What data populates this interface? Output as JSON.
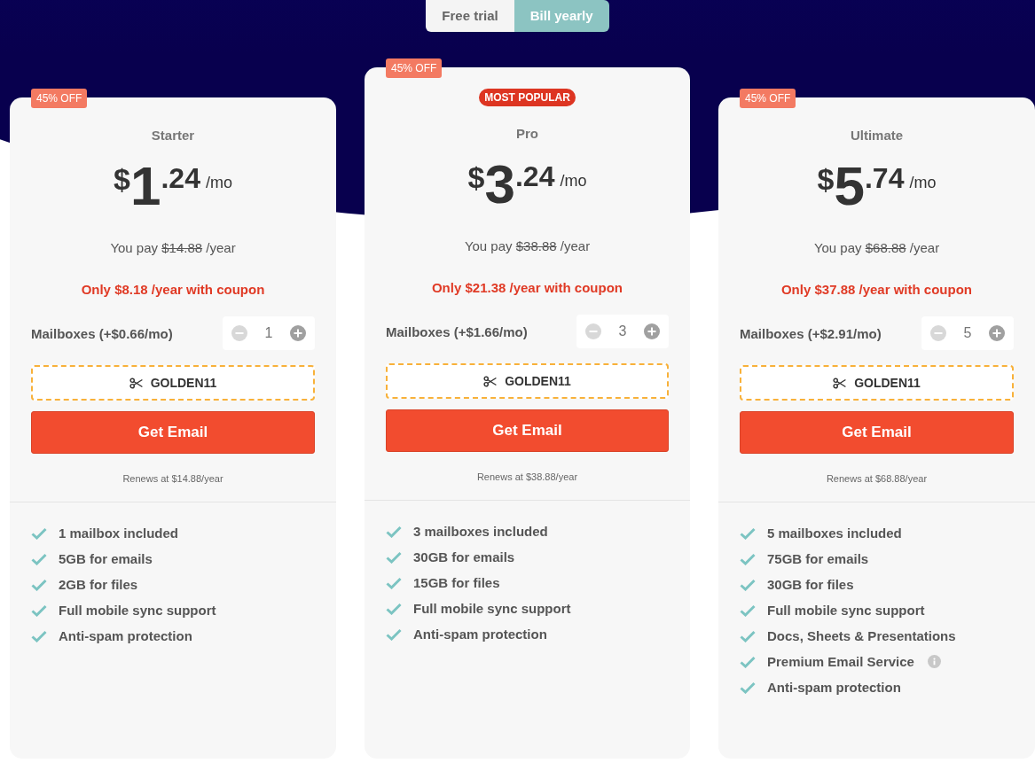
{
  "billing_toggle": [
    {
      "label": "Free trial",
      "selected": false
    },
    {
      "label": "Bill yearly",
      "selected": true
    }
  ],
  "plans": [
    {
      "discount_badge": "45% OFF",
      "name": "Starter",
      "price": {
        "currency": "$",
        "whole": "1",
        "cents": ".24",
        "period": "/mo"
      },
      "you_pay": {
        "prefix": "You pay",
        "old_price": "$14.88",
        "suffix": "/year"
      },
      "coupon_offer": "Only $8.18 /year with coupon",
      "mailboxes_label": "Mailboxes (+$0.66/mo)",
      "mailboxes_count": "1",
      "coupon_code": "GOLDEN11",
      "cta": "Get Email",
      "renews": "Renews at $14.88/year",
      "features": [
        {
          "text": "1 mailbox included",
          "info": false
        },
        {
          "text": "5GB for emails",
          "info": false
        },
        {
          "text": "2GB for files",
          "info": false
        },
        {
          "text": "Full mobile sync support",
          "info": false
        },
        {
          "text": "Anti-spam protection",
          "info": false
        }
      ]
    },
    {
      "discount_badge": "45% OFF",
      "highlight_badge": "MOST POPULAR",
      "name": "Pro",
      "price": {
        "currency": "$",
        "whole": "3",
        "cents": ".24",
        "period": "/mo"
      },
      "you_pay": {
        "prefix": "You pay",
        "old_price": "$38.88",
        "suffix": "/year"
      },
      "coupon_offer": "Only $21.38 /year with coupon",
      "mailboxes_label": "Mailboxes (+$1.66/mo)",
      "mailboxes_count": "3",
      "coupon_code": "GOLDEN11",
      "cta": "Get Email",
      "renews": "Renews at $38.88/year",
      "features": [
        {
          "text": "3 mailboxes included",
          "info": false
        },
        {
          "text": "30GB for emails",
          "info": false
        },
        {
          "text": "15GB for files",
          "info": false
        },
        {
          "text": "Full mobile sync support",
          "info": false
        },
        {
          "text": "Anti-spam protection",
          "info": false
        }
      ]
    },
    {
      "discount_badge": "45% OFF",
      "name": "Ultimate",
      "price": {
        "currency": "$",
        "whole": "5",
        "cents": ".74",
        "period": "/mo"
      },
      "you_pay": {
        "prefix": "You pay",
        "old_price": "$68.88",
        "suffix": "/year"
      },
      "coupon_offer": "Only $37.88 /year with coupon",
      "mailboxes_label": "Mailboxes (+$2.91/mo)",
      "mailboxes_count": "5",
      "coupon_code": "GOLDEN11",
      "cta": "Get Email",
      "renews": "Renews at $68.88/year",
      "features": [
        {
          "text": "5 mailboxes included",
          "info": false
        },
        {
          "text": "75GB for emails",
          "info": false
        },
        {
          "text": "30GB for files",
          "info": false
        },
        {
          "text": "Full mobile sync support",
          "info": false
        },
        {
          "text": "Docs, Sheets & Presentations",
          "info": false
        },
        {
          "text": "Premium Email Service",
          "info": true
        },
        {
          "text": "Anti-spam protection",
          "info": false
        }
      ]
    }
  ]
}
